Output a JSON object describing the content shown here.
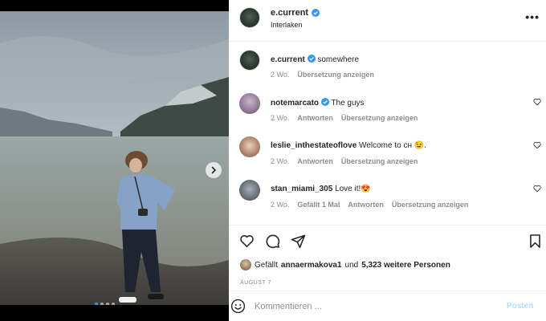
{
  "post": {
    "username": "e.current",
    "location": "Interlaken",
    "more_icon": "more-horizontal-icon",
    "carousel": {
      "slide_count": 4,
      "active_slide": 1
    }
  },
  "comments": [
    {
      "username": "e.current",
      "text": "somewhere",
      "verified": true,
      "time": "2 Wo.",
      "reply": "",
      "likes": "",
      "translate": "Übersetzung anzeigen",
      "has_heart": false
    },
    {
      "username": "notemarcato",
      "text": "The guys",
      "verified": true,
      "time": "2 Wo.",
      "reply": "Antworten",
      "likes": "",
      "translate": "Übersetzung anzeigen",
      "has_heart": true
    },
    {
      "username": "leslie_inthestateoflove",
      "text": "Welcome to ᴄʜ 😉.",
      "verified": false,
      "time": "2 Wo.",
      "reply": "Antworten",
      "likes": "",
      "translate": "Übersetzung anzeigen",
      "has_heart": true
    },
    {
      "username": "stan_miami_305",
      "text": "Love it!😍",
      "verified": false,
      "time": "2 Wo.",
      "reply": "Antworten",
      "likes": "Gefällt 1 Mal",
      "translate": "Übersetzung anzeigen",
      "has_heart": true
    }
  ],
  "likes": {
    "prefix": "Gefällt",
    "user": "annaermakova1",
    "connector": "und",
    "others": "5,323 weitere Personen"
  },
  "date": "AUGUST 7",
  "composer": {
    "placeholder": "Kommentieren ...",
    "post_label": "Posten"
  },
  "colors": {
    "verified": "#3897f0",
    "post_disabled": "#b2dffc",
    "meta_text": "#8e8e8e"
  }
}
